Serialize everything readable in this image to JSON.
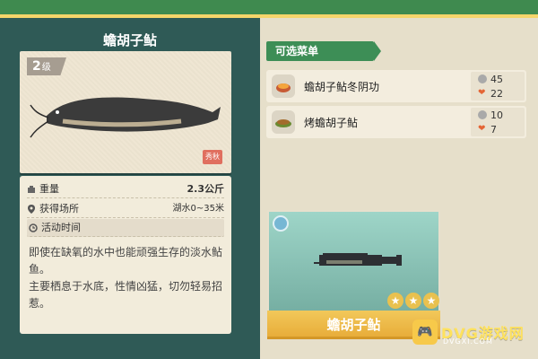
{
  "left": {
    "title": "蟾胡子鲇",
    "level": {
      "num": "2",
      "suffix": "级"
    },
    "seal_text": "秀秋",
    "info": {
      "weight_label": "重量",
      "weight_value": "2.3公斤",
      "location_label": "获得场所",
      "location_value": "湖水0~35米",
      "activity_label": "活动时间"
    },
    "description": "即使在缺氧的水中也能顽强生存的淡水鲇鱼。\n主要栖息于水底，性情凶猛，切勿轻易招惹。"
  },
  "menu": {
    "header": "可选菜单",
    "dishes": [
      {
        "name": "蟾胡子鲇冬阴功",
        "coin": "45",
        "heart": "22"
      },
      {
        "name": "烤蟾胡子鲇",
        "coin": "10",
        "heart": "7"
      }
    ]
  },
  "fish_view": {
    "name": "蟾胡子鲇",
    "stars": 3
  },
  "watermark": {
    "brand": "DVG游戏网",
    "sub": "DVGXI.COM"
  },
  "colors": {
    "left_panel": "#2f5a56",
    "menu_header": "#3d8e56",
    "name_bar": "#e8ad3a"
  }
}
